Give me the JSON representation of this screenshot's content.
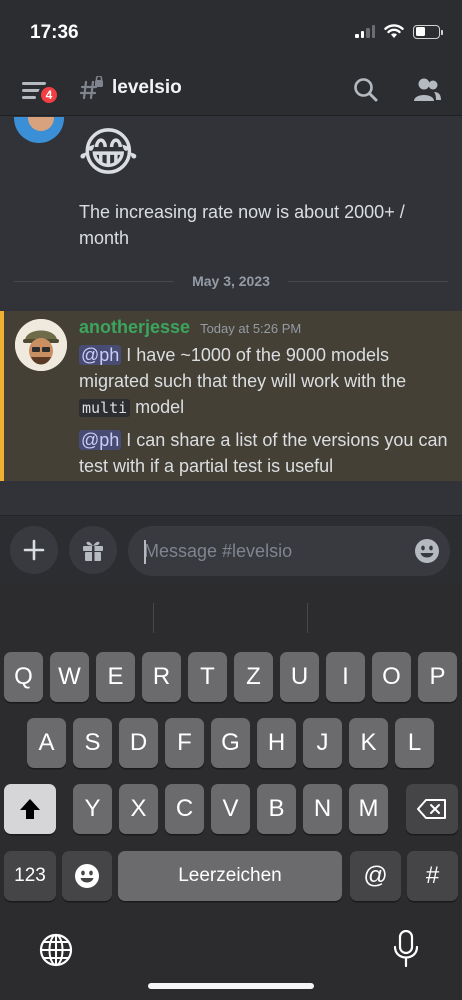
{
  "status_bar": {
    "time": "17:36",
    "battery_level": 0.45
  },
  "header": {
    "notification_count": "4",
    "channel_name": "levelsio"
  },
  "messages": {
    "previous": {
      "emoji": "😂",
      "text": "The increasing rate now is about 2000+ / month"
    },
    "date_divider": "May 3, 2023",
    "highlighted": {
      "author": "anotherjesse",
      "timestamp": "Today at 5:26 PM",
      "author_color": "#3ba55d",
      "line1_mention": "@ph",
      "line1_pre": " I have ~1000 of the 9000 models migrated such that they will work with the ",
      "line1_code": "multi",
      "line1_post": " model",
      "line2_mention": "@ph",
      "line2_text": " I can share a list of the versions you can test with if a partial test is useful"
    }
  },
  "composer": {
    "placeholder": "Message #levelsio"
  },
  "keyboard": {
    "row1": [
      "Q",
      "W",
      "E",
      "R",
      "T",
      "Z",
      "U",
      "I",
      "O",
      "P"
    ],
    "row2": [
      "A",
      "S",
      "D",
      "F",
      "G",
      "H",
      "J",
      "K",
      "L"
    ],
    "row3": [
      "Y",
      "X",
      "C",
      "V",
      "B",
      "N",
      "M"
    ],
    "numbers_key": "123",
    "space_key": "Leerzeichen",
    "at_key": "@",
    "hash_key": "#"
  },
  "colors": {
    "highlight_bar": "#f0b132",
    "mention_bg": "#484c73",
    "badge": "#f23f43"
  }
}
